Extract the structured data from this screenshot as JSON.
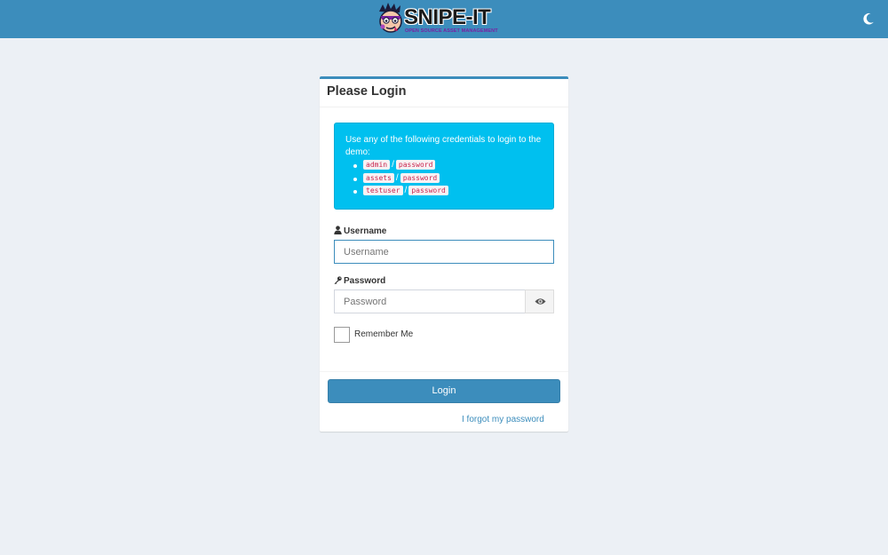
{
  "header": {
    "brand_title": "SNIPE-IT",
    "brand_subtitle": "OPEN SOURCE ASSET MANAGEMENT",
    "theme_toggle_icon": "moon-icon",
    "bar_color": "#3c8dbc"
  },
  "login_card": {
    "title": "Please Login",
    "demo_alert": {
      "intro": "Use any of the following credentials to login to the demo:",
      "separator": "/",
      "credentials": [
        {
          "username": "admin",
          "password": "password"
        },
        {
          "username": "assets",
          "password": "password"
        },
        {
          "username": "testuser",
          "password": "password"
        }
      ]
    },
    "username": {
      "label": "Username",
      "icon": "user-icon",
      "placeholder": "Username",
      "value": ""
    },
    "password": {
      "label": "Password",
      "icon": "key-icon",
      "placeholder": "Password",
      "value": "",
      "toggle_icon": "eye-icon"
    },
    "remember_me": {
      "label": "Remember Me",
      "checked": false
    },
    "login_button": "Login",
    "forgot_link": "I forgot my password"
  },
  "colors": {
    "primary": "#3c8dbc",
    "info": "#00c0ef",
    "background": "#ecf0f5"
  }
}
